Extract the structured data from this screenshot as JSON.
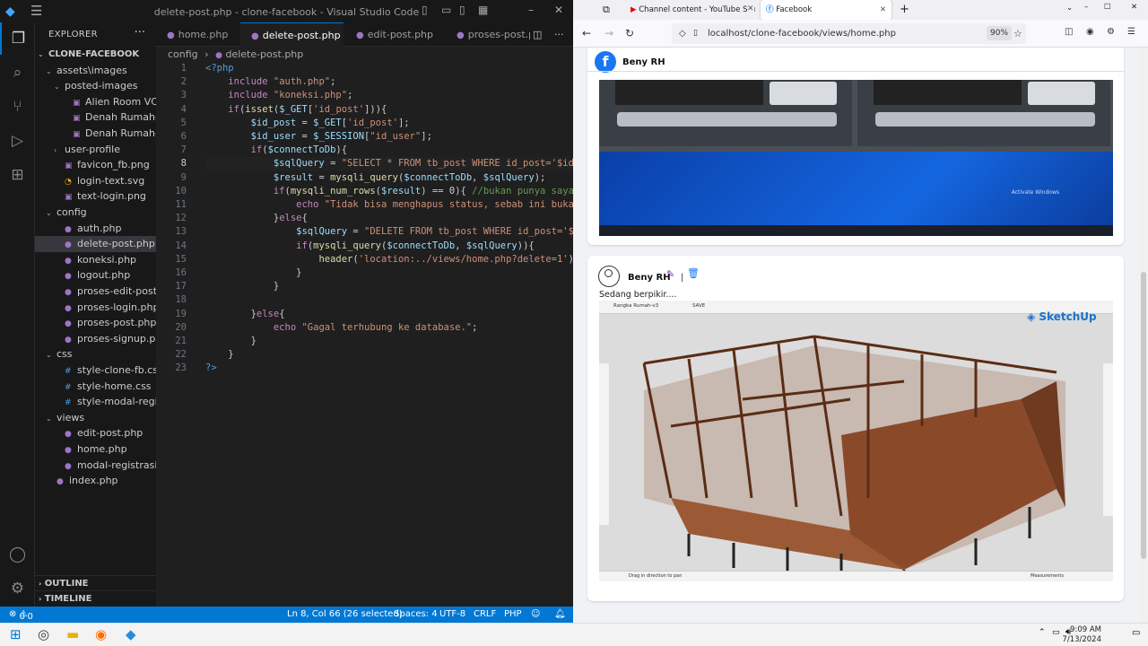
{
  "vscode": {
    "window_title": "delete-post.php - clone-facebook - Visual Studio Code",
    "explorer_header": "EXPLORER",
    "tree": [
      {
        "label": "CLONE-FACEBOOK",
        "depth": 0,
        "kind": "folder-open",
        "bold": true
      },
      {
        "label": "assets\\images",
        "depth": 1,
        "kind": "folder-open"
      },
      {
        "label": "posted-images",
        "depth": 2,
        "kind": "folder-open"
      },
      {
        "label": "Alien Room VC.png",
        "depth": 3,
        "kind": "img"
      },
      {
        "label": "Denah Rumah-1.png",
        "depth": 3,
        "kind": "img"
      },
      {
        "label": "Denah Rumah-2.png",
        "depth": 3,
        "kind": "img"
      },
      {
        "label": "user-profile",
        "depth": 2,
        "kind": "folder"
      },
      {
        "label": "favicon_fb.png",
        "depth": 2,
        "kind": "img"
      },
      {
        "label": "login-text.svg",
        "depth": 2,
        "kind": "svg"
      },
      {
        "label": "text-login.png",
        "depth": 2,
        "kind": "img"
      },
      {
        "label": "config",
        "depth": 1,
        "kind": "folder-open"
      },
      {
        "label": "auth.php",
        "depth": 2,
        "kind": "php"
      },
      {
        "label": "delete-post.php",
        "depth": 2,
        "kind": "php",
        "selected": true
      },
      {
        "label": "koneksi.php",
        "depth": 2,
        "kind": "php"
      },
      {
        "label": "logout.php",
        "depth": 2,
        "kind": "php"
      },
      {
        "label": "proses-edit-post.php",
        "depth": 2,
        "kind": "php"
      },
      {
        "label": "proses-login.php",
        "depth": 2,
        "kind": "php"
      },
      {
        "label": "proses-post.php",
        "depth": 2,
        "kind": "php"
      },
      {
        "label": "proses-signup.php",
        "depth": 2,
        "kind": "php"
      },
      {
        "label": "css",
        "depth": 1,
        "kind": "folder-open"
      },
      {
        "label": "style-clone-fb.css",
        "depth": 2,
        "kind": "css"
      },
      {
        "label": "style-home.css",
        "depth": 2,
        "kind": "css"
      },
      {
        "label": "style-modal-registra...",
        "depth": 2,
        "kind": "css"
      },
      {
        "label": "views",
        "depth": 1,
        "kind": "folder-open"
      },
      {
        "label": "edit-post.php",
        "depth": 2,
        "kind": "php"
      },
      {
        "label": "home.php",
        "depth": 2,
        "kind": "php"
      },
      {
        "label": "modal-registrasi.php",
        "depth": 2,
        "kind": "php"
      },
      {
        "label": "index.php",
        "depth": 1,
        "kind": "php"
      }
    ],
    "outline_label": "OUTLINE",
    "timeline_label": "TIMELINE",
    "tabs": [
      {
        "label": "home.php",
        "active": false
      },
      {
        "label": "delete-post.php",
        "active": true
      },
      {
        "label": "edit-post.php",
        "active": false
      },
      {
        "label": "proses-post.p",
        "active": false
      }
    ],
    "breadcrumb": [
      "config",
      "delete-post.php"
    ],
    "code_lines": [
      "<?php",
      "    include \"auth.php\";",
      "    include \"koneksi.php\";",
      "    if(isset($_GET['id_post'])){",
      "        $id_post = $_GET['id_post'];",
      "        $id_user = $_SESSION[\"id_user\"];",
      "        if($connectToDb){",
      "            $sqlQuery = \"SELECT * FROM tb_post WHERE id_post='$id_",
      "            $result = mysqli_query($connectToDb, $sqlQuery);",
      "            if(mysqli_num_rows($result) == 0){ //bukan punya saya",
      "                echo \"Tidak bisa menghapus status, sebab ini bukan",
      "            }else{",
      "                $sqlQuery = \"DELETE FROM tb_post WHERE id_post='$id",
      "                if(mysqli_query($connectToDb, $sqlQuery)){",
      "                    header('location:../views/home.php?delete=1');",
      "                }",
      "            }",
      "",
      "        }else{",
      "            echo \"Gagal terhubung ke database.\";",
      "        }",
      "    }",
      "?>"
    ],
    "current_line": 8,
    "status": {
      "problems": "0",
      "warnings": "0",
      "position": "Ln 8, Col 66 (26 selected)",
      "spaces": "Spaces: 4",
      "encoding": "UTF-8",
      "eol": "CRLF",
      "language": "PHP"
    }
  },
  "firefox": {
    "tabs": [
      {
        "label": "Channel content - YouTube Stu",
        "active": false
      },
      {
        "label": "Facebook",
        "active": true
      }
    ],
    "url": "localhost/clone-facebook/views/home.php",
    "zoom": "90%",
    "page": {
      "header_user": "Beny RH",
      "post": {
        "author": "Beny RH",
        "separator": "|",
        "text": "Sedang berpikir....",
        "sketchup_brand": "SketchUp",
        "sketchup_file": "Rangka Rumah-v3",
        "sketchup_save": "SAVE",
        "sketchup_hint": "Drag in direction to pan",
        "sketchup_measurements": "Measurements"
      },
      "prev_image_watermark": "Activate Windows"
    }
  },
  "taskbar": {
    "time": "9:09 AM",
    "date": "7/13/2024"
  },
  "colors": {
    "vscode_accent": "#0078d4",
    "fb_blue": "#1877f2",
    "php_purple": "#a074c4"
  }
}
